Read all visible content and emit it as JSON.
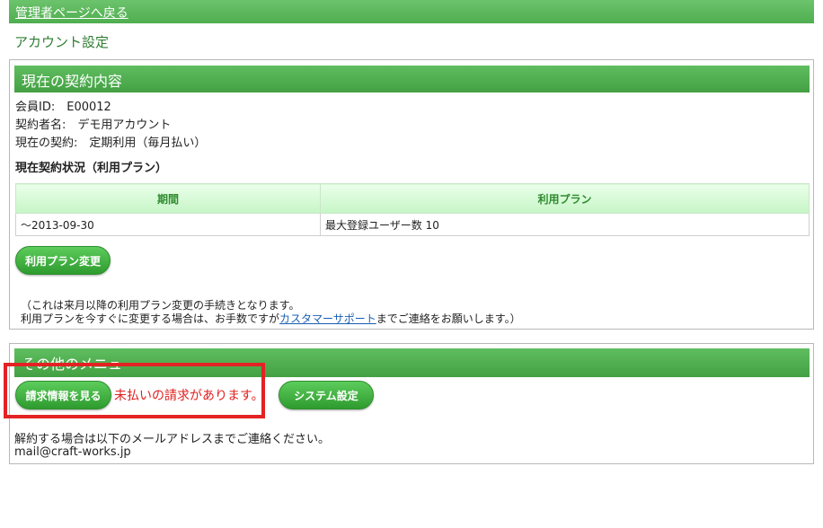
{
  "topbar": {
    "back_link": "管理者ページへ戻る"
  },
  "page": {
    "title": "アカウント設定"
  },
  "contract": {
    "heading": "現在の契約内容",
    "member_id": "会員ID:　E00012",
    "contractor": "契約者名:　デモ用アカウント",
    "current_contract": "現在の契約:　定期利用（毎月払い）",
    "status_heading": "現在契約状況（利用プラン）",
    "table": {
      "headers": [
        "期間",
        "利用プラン"
      ],
      "rows": [
        [
          "～2013-09-30",
          "最大登録ユーザー数 10"
        ]
      ]
    },
    "change_plan_button": "利用プラン変更",
    "note_line1": "（これは来月以降の利用プラン変更の手続きとなります。",
    "note_line2_pre": "利用プランを今すぐに変更する場合は、お手数ですが",
    "note_link": "カスタマーサポート",
    "note_line2_post": "までご連絡をお願いします。）"
  },
  "other_menu": {
    "heading": "その他のメニュー",
    "billing_button": "請求情報を見る",
    "unpaid_alert": "未払いの請求があります。",
    "system_button": "システム設定",
    "cancel_text": "解約する場合は以下のメールアドレスまでご連絡ください。",
    "email": "mail@craft-works.jp"
  },
  "colors": {
    "accent_green": "#4fae4f",
    "alert_red": "#e32224"
  }
}
